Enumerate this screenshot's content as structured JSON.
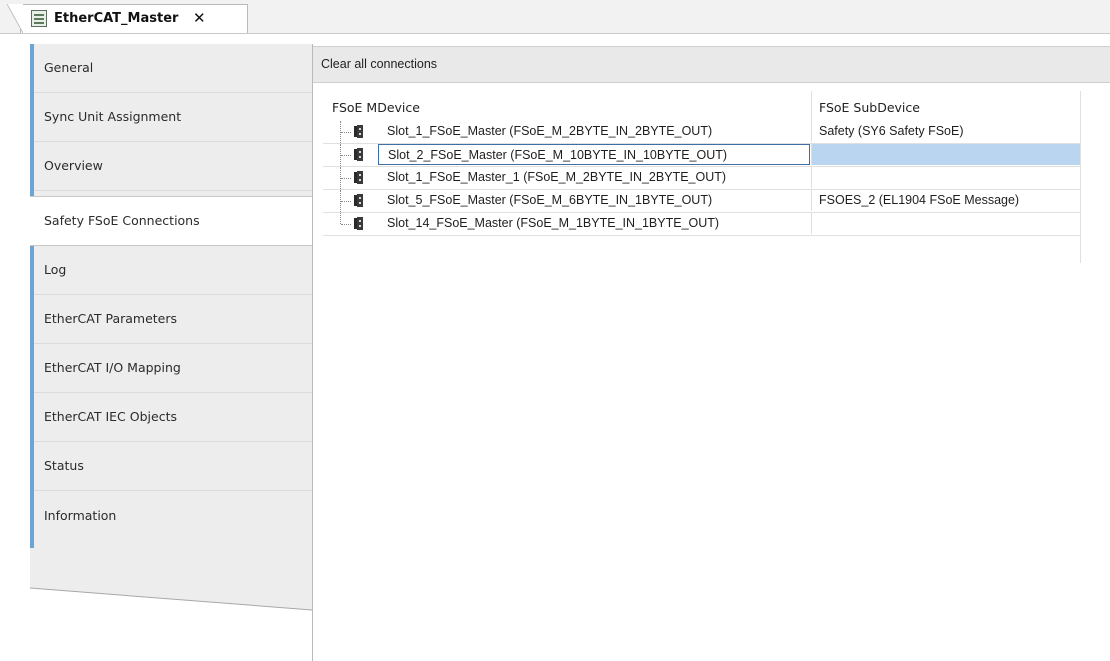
{
  "tab": {
    "title": "EtherCAT_Master",
    "close_glyph": "✕",
    "icon": "device-config-icon"
  },
  "nav": {
    "items": [
      {
        "label": "General"
      },
      {
        "label": "Sync Unit Assignment"
      },
      {
        "label": "Overview"
      },
      {
        "label": "Safety FSoE Connections",
        "active": true
      },
      {
        "label": "Log"
      },
      {
        "label": "EtherCAT Parameters"
      },
      {
        "label": "EtherCAT I/O Mapping"
      },
      {
        "label": "EtherCAT IEC Objects"
      },
      {
        "label": "Status"
      },
      {
        "label": "Information"
      }
    ]
  },
  "toolbar": {
    "clear_label": "Clear all connections"
  },
  "table": {
    "headers": {
      "mdevice": "FSoE MDevice",
      "subdevice": "FSoE SubDevice"
    },
    "rows": [
      {
        "mdevice": "Slot_1_FSoE_Master (FSoE_M_2BYTE_IN_2BYTE_OUT)",
        "subdevice": "Safety (SY6 Safety FSoE)"
      },
      {
        "mdevice": "Slot_2_FSoE_Master (FSoE_M_10BYTE_IN_10BYTE_OUT)",
        "subdevice": "",
        "selected": true
      },
      {
        "mdevice": "Slot_1_FSoE_Master_1 (FSoE_M_2BYTE_IN_2BYTE_OUT)",
        "subdevice": ""
      },
      {
        "mdevice": "Slot_5_FSoE_Master (FSoE_M_6BYTE_IN_1BYTE_OUT)",
        "subdevice": "FSOES_2 (EL1904 FSoE Message)"
      },
      {
        "mdevice": "Slot_14_FSoE_Master (FSoE_M_1BYTE_IN_1BYTE_OUT)",
        "subdevice": ""
      }
    ],
    "row_icon": "safety-module-icon"
  },
  "colors": {
    "accent": "#6fa3d6",
    "selection": "#b9d5ef",
    "selection_border": "#3f6fa8"
  }
}
